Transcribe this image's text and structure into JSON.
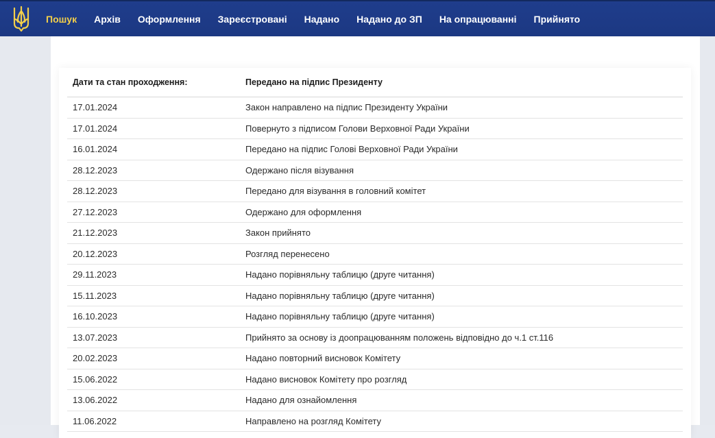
{
  "nav": {
    "items": [
      "Пошук",
      "Архів",
      "Оформлення",
      "Зареєстровані",
      "Надано",
      "Надано до ЗП",
      "На опрацюванні",
      "Прийнято"
    ],
    "active_index": 0
  },
  "logo": {
    "icon": "trident-icon",
    "color": "#f3cf4a"
  },
  "table": {
    "headers": [
      "Дати та стан проходження:",
      "Передано на підпис Президенту"
    ],
    "rows": [
      [
        "17.01.2024",
        "Закон направлено на підпис Президенту України"
      ],
      [
        "17.01.2024",
        "Повернуто з підписом Голови Верховної Ради України"
      ],
      [
        "16.01.2024",
        "Передано на підпис Голові Верховної Ради України"
      ],
      [
        "28.12.2023",
        "Одержано після візування"
      ],
      [
        "28.12.2023",
        "Передано для візування в головний комітет"
      ],
      [
        "27.12.2023",
        "Одержано для оформлення"
      ],
      [
        "21.12.2023",
        "Закон прийнято"
      ],
      [
        "20.12.2023",
        "Розгляд перенесено"
      ],
      [
        "29.11.2023",
        "Надано порівняльну таблицю (друге читання)"
      ],
      [
        "15.11.2023",
        "Надано порівняльну таблицю (друге читання)"
      ],
      [
        "16.10.2023",
        "Надано порівняльну таблицю (друге читання)"
      ],
      [
        "13.07.2023",
        "Прийнято за основу із доопрацюванням положень відповідно до ч.1 ст.116"
      ],
      [
        "20.02.2023",
        "Надано повторний висновок Комітету"
      ],
      [
        "15.06.2022",
        "Надано висновок Комітету про розгляд"
      ],
      [
        "13.06.2022",
        "Надано для ознайомлення"
      ],
      [
        "11.06.2022",
        "Направлено на розгляд Комітету"
      ]
    ]
  },
  "colors": {
    "header_bg": "#1f3d8c",
    "active_nav": "#f3cf4a",
    "nav_text": "#ffffff"
  }
}
